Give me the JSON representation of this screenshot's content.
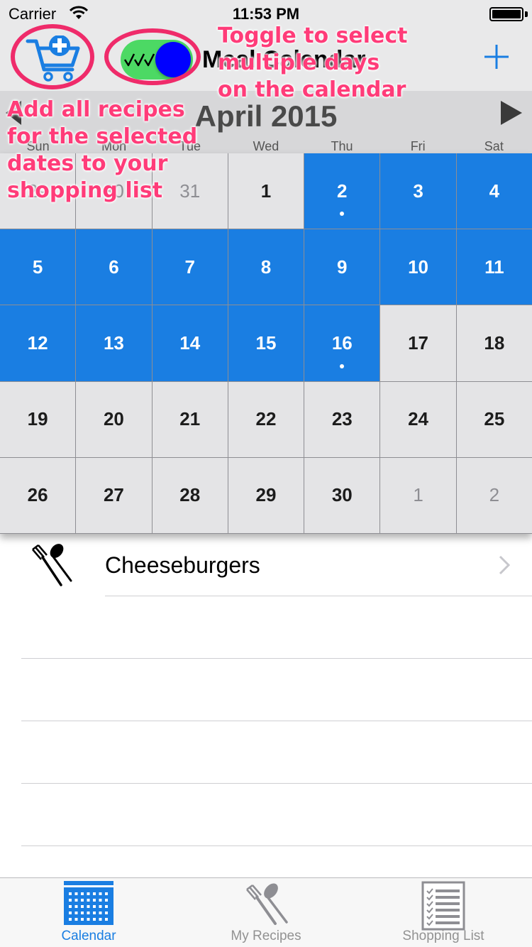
{
  "status_bar": {
    "carrier": "Carrier",
    "time": "11:53 PM"
  },
  "nav": {
    "title": "Meal Calendar",
    "toggle_on": true
  },
  "calendar": {
    "month_title": "April 2015",
    "weekdays": [
      "Sun",
      "Mon",
      "Tue",
      "Wed",
      "Thu",
      "Fri",
      "Sat"
    ],
    "days": [
      {
        "label": "29",
        "current_month": false,
        "selected": false,
        "has_event": false
      },
      {
        "label": "30",
        "current_month": false,
        "selected": false,
        "has_event": false
      },
      {
        "label": "31",
        "current_month": false,
        "selected": false,
        "has_event": false
      },
      {
        "label": "1",
        "current_month": true,
        "selected": false,
        "has_event": false
      },
      {
        "label": "2",
        "current_month": true,
        "selected": true,
        "has_event": true
      },
      {
        "label": "3",
        "current_month": true,
        "selected": true,
        "has_event": false
      },
      {
        "label": "4",
        "current_month": true,
        "selected": true,
        "has_event": false
      },
      {
        "label": "5",
        "current_month": true,
        "selected": true,
        "has_event": false
      },
      {
        "label": "6",
        "current_month": true,
        "selected": true,
        "has_event": false
      },
      {
        "label": "7",
        "current_month": true,
        "selected": true,
        "has_event": false
      },
      {
        "label": "8",
        "current_month": true,
        "selected": true,
        "has_event": false
      },
      {
        "label": "9",
        "current_month": true,
        "selected": true,
        "has_event": false
      },
      {
        "label": "10",
        "current_month": true,
        "selected": true,
        "has_event": false
      },
      {
        "label": "11",
        "current_month": true,
        "selected": true,
        "has_event": false
      },
      {
        "label": "12",
        "current_month": true,
        "selected": true,
        "has_event": false
      },
      {
        "label": "13",
        "current_month": true,
        "selected": true,
        "has_event": false
      },
      {
        "label": "14",
        "current_month": true,
        "selected": true,
        "has_event": false
      },
      {
        "label": "15",
        "current_month": true,
        "selected": true,
        "has_event": false
      },
      {
        "label": "16",
        "current_month": true,
        "selected": true,
        "has_event": true
      },
      {
        "label": "17",
        "current_month": true,
        "selected": false,
        "has_event": false
      },
      {
        "label": "18",
        "current_month": true,
        "selected": false,
        "has_event": false
      },
      {
        "label": "19",
        "current_month": true,
        "selected": false,
        "has_event": false
      },
      {
        "label": "20",
        "current_month": true,
        "selected": false,
        "has_event": false
      },
      {
        "label": "21",
        "current_month": true,
        "selected": false,
        "has_event": false
      },
      {
        "label": "22",
        "current_month": true,
        "selected": false,
        "has_event": false
      },
      {
        "label": "23",
        "current_month": true,
        "selected": false,
        "has_event": false
      },
      {
        "label": "24",
        "current_month": true,
        "selected": false,
        "has_event": false
      },
      {
        "label": "25",
        "current_month": true,
        "selected": false,
        "has_event": false
      },
      {
        "label": "26",
        "current_month": true,
        "selected": false,
        "has_event": false
      },
      {
        "label": "27",
        "current_month": true,
        "selected": false,
        "has_event": false
      },
      {
        "label": "28",
        "current_month": true,
        "selected": false,
        "has_event": false
      },
      {
        "label": "29",
        "current_month": true,
        "selected": false,
        "has_event": false
      },
      {
        "label": "30",
        "current_month": true,
        "selected": false,
        "has_event": false
      },
      {
        "label": "1",
        "current_month": false,
        "selected": false,
        "has_event": false
      },
      {
        "label": "2",
        "current_month": false,
        "selected": false,
        "has_event": false
      }
    ]
  },
  "recipes": [
    {
      "name": "Cheeseburgers",
      "icon": "fork-spoon-icon"
    }
  ],
  "tabs": [
    {
      "label": "Calendar",
      "icon": "calendar-icon",
      "active": true
    },
    {
      "label": "My Recipes",
      "icon": "fork-spoon-icon",
      "active": false
    },
    {
      "label": "Shopping List",
      "icon": "checklist-icon",
      "active": false
    }
  ],
  "annotations": {
    "toggle_note": "Toggle to select\nmultiple days\non the calendar",
    "cart_note": "Add all recipes\nfor the selected\ndates to your\nshopping list",
    "color": "#ff3c79"
  },
  "colors": {
    "accent": "#1a7ee2",
    "toggle_track": "#4cd964",
    "toggle_knob": "#0000ff",
    "annotation": "#ef2b6a"
  }
}
